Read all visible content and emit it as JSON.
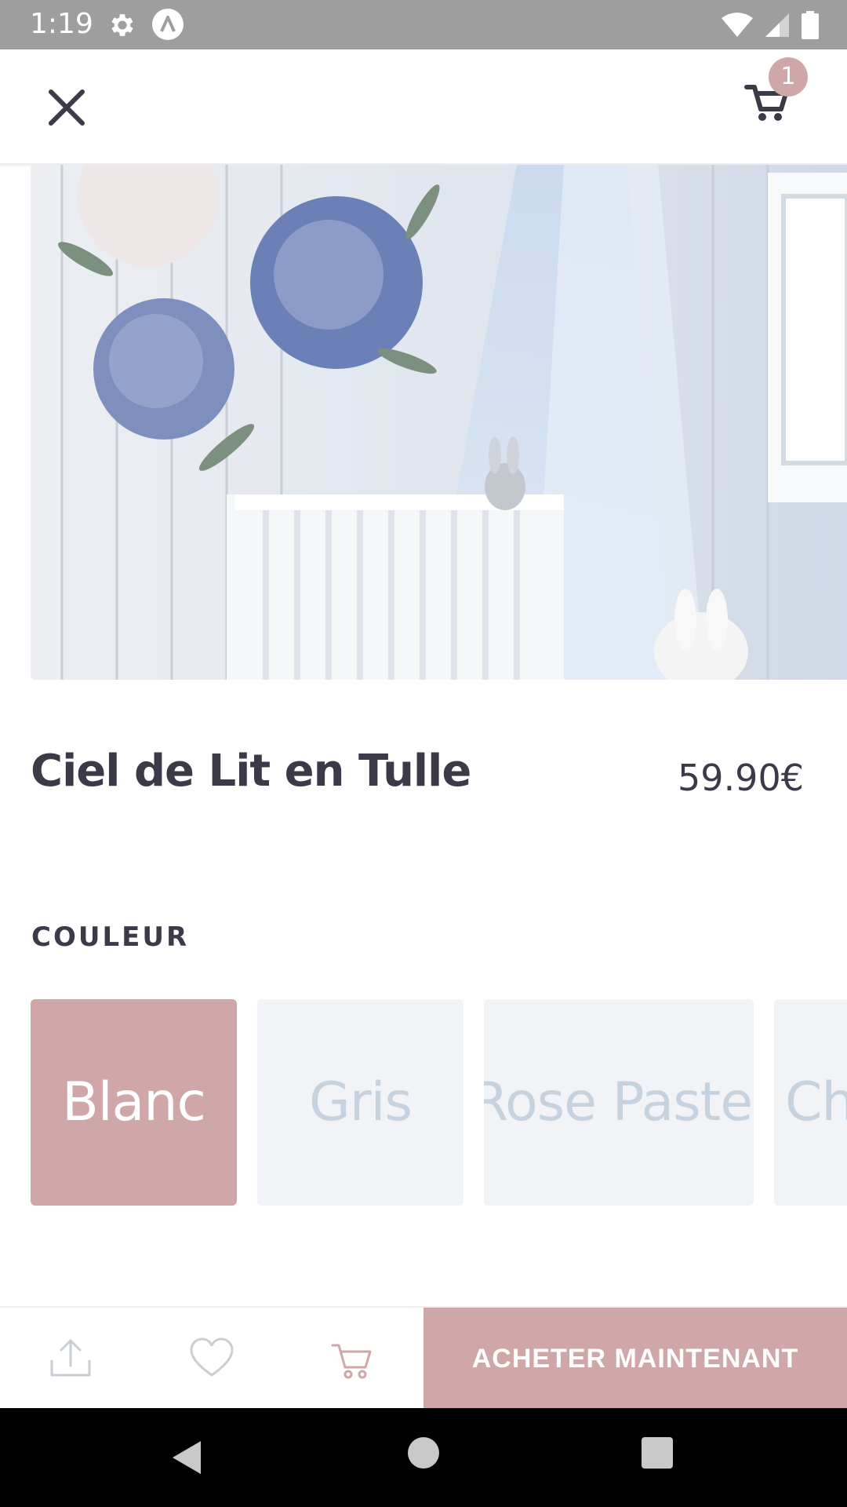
{
  "status_bar": {
    "time": "1:19",
    "icons": [
      "gear-icon",
      "a-circle-icon",
      "wifi-icon",
      "signal-icon",
      "battery-icon"
    ]
  },
  "app_bar": {
    "close_icon": "close-icon",
    "cart_icon": "cart-icon",
    "cart_badge": "1"
  },
  "product": {
    "image_alt": "nursery with tulle canopy over white crib",
    "title": "Ciel de Lit en Tulle",
    "price": "59.90€"
  },
  "options": {
    "label": "COULEUR",
    "colors": [
      {
        "label": "Blanc",
        "selected": true
      },
      {
        "label": "Gris",
        "selected": false
      },
      {
        "label": "Rose Pastel",
        "selected": false
      },
      {
        "label": "Ch",
        "selected": false
      }
    ]
  },
  "bottom_bar": {
    "share_icon": "share-icon",
    "favorite_icon": "heart-icon",
    "cart_icon": "cart-outline-icon",
    "buy_label": "ACHETER MAINTENANT"
  },
  "colors": {
    "accent": "#cfa7a8",
    "text": "#3a3a48",
    "swatch_bg": "#f1f3f6",
    "swatch_text": "#c6d3df",
    "status_bar": "#9e9e9e"
  }
}
